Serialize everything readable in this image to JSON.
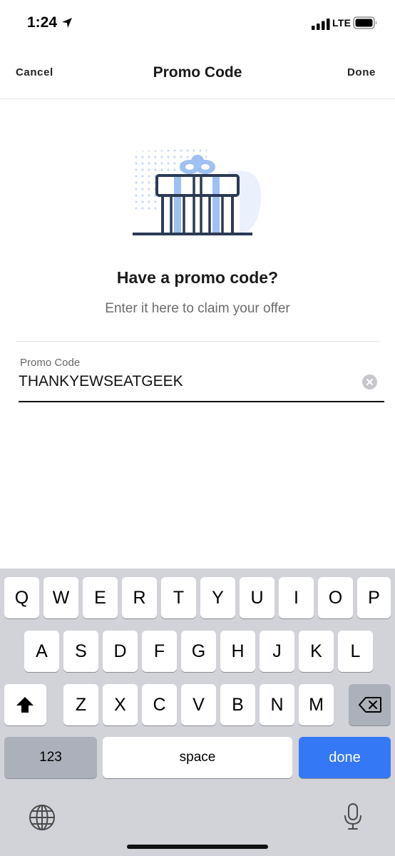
{
  "status": {
    "time": "1:24",
    "network": "LTE"
  },
  "nav": {
    "cancel": "Cancel",
    "title": "Promo Code",
    "done": "Done"
  },
  "content": {
    "heading": "Have a promo code?",
    "subheading": "Enter it here to claim your offer"
  },
  "field": {
    "label": "Promo Code",
    "value": "THANKYEWSEATGEEK"
  },
  "keyboard": {
    "row1": [
      "Q",
      "W",
      "E",
      "R",
      "T",
      "Y",
      "U",
      "I",
      "O",
      "P"
    ],
    "row2": [
      "A",
      "S",
      "D",
      "F",
      "G",
      "H",
      "J",
      "K",
      "L"
    ],
    "row3": [
      "Z",
      "X",
      "C",
      "V",
      "B",
      "N",
      "M"
    ],
    "numbers": "123",
    "space": "space",
    "done": "done"
  },
  "colors": {
    "accent": "#3478f6",
    "illustration_navy": "#2b3a55",
    "illustration_blue": "#9ec0f2"
  },
  "icons": [
    "location-arrow-icon",
    "signal-icon",
    "battery-icon",
    "gift-icon",
    "clear-icon",
    "shift-icon",
    "backspace-icon",
    "globe-icon",
    "microphone-icon"
  ]
}
